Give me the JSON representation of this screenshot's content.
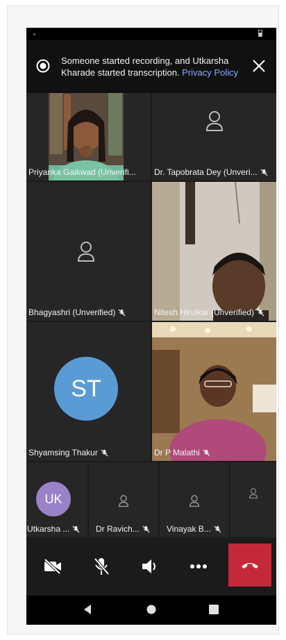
{
  "banner": {
    "message": "Someone started recording, and Utkarsha Kharade started transcription.",
    "link": "Privacy Policy"
  },
  "participants": [
    {
      "name": "Priyanka Gaikwad  (Unverifi...",
      "muted": false,
      "video": true
    },
    {
      "name": "Dr. Tapobrata Dey (Unveri...",
      "muted": true,
      "video": false
    },
    {
      "name": "Bhagyashri  (Unverified)",
      "muted": true,
      "video": false
    },
    {
      "name": "Nitesh Hirulkar (Unverified)",
      "muted": true,
      "video": true
    },
    {
      "name": "Shyamsing Thakur",
      "muted": true,
      "video": false,
      "initials": "ST",
      "avatar_color": "#5b9bd5"
    },
    {
      "name": "Dr P Malathi",
      "muted": true,
      "video": true
    }
  ],
  "small_participants": [
    {
      "name": "Utkarsha  ...",
      "muted": true,
      "initials": "UK",
      "avatar_color": "#9a82c8"
    },
    {
      "name": "Dr Ravich...",
      "muted": true
    },
    {
      "name": "Vinayak B...",
      "muted": true
    },
    {
      "name": "",
      "muted": false
    }
  ],
  "controls": [
    "camera-off-icon",
    "mic-off-icon",
    "speaker-icon",
    "more-icon",
    "end-call-icon"
  ],
  "colors": {
    "tile_bg": "#262626",
    "hangup": "#c4293a",
    "link": "#8fa8ff"
  }
}
